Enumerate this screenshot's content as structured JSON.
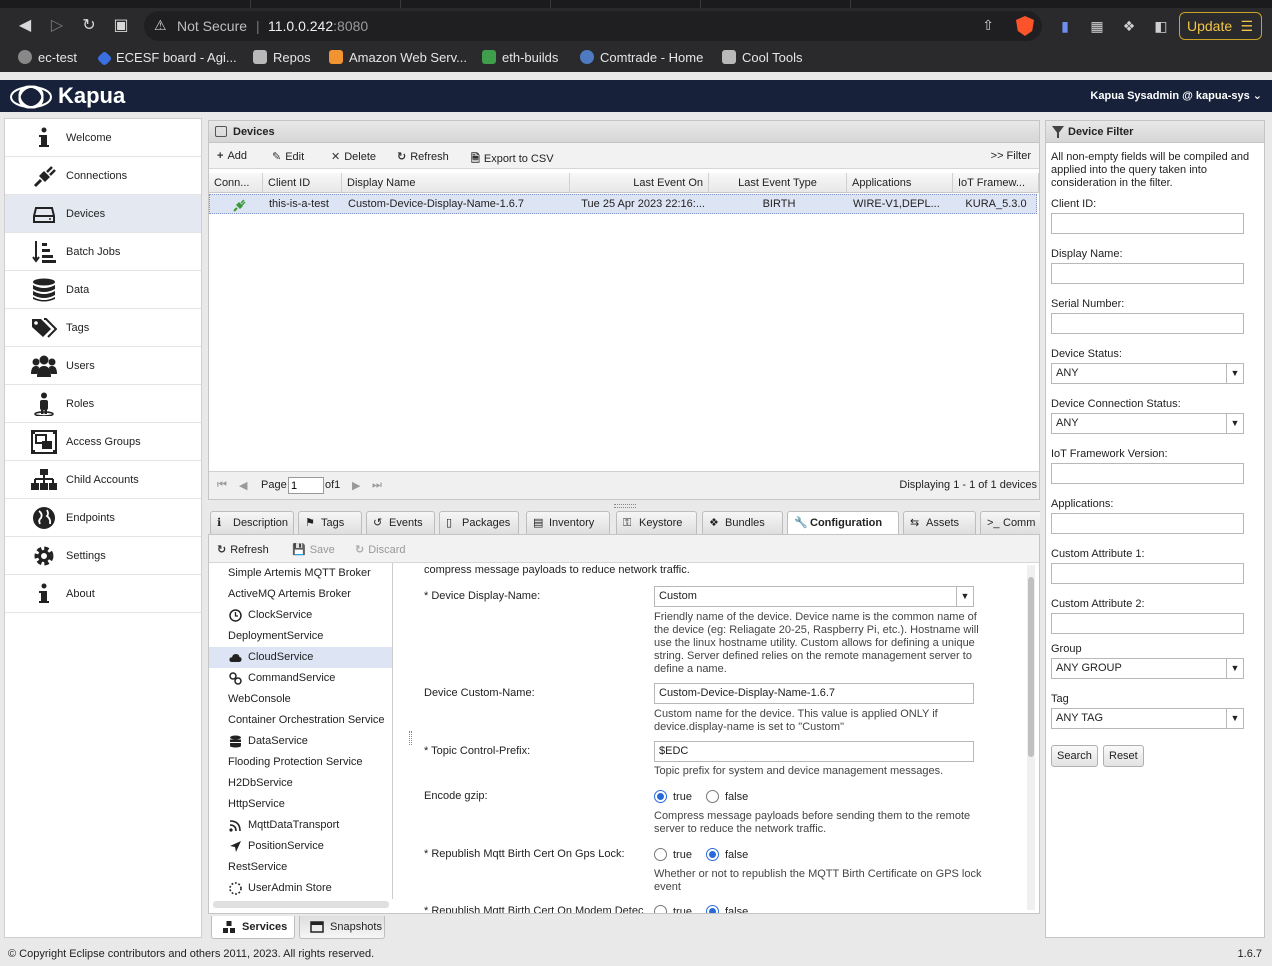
{
  "browser": {
    "security_label": "Not Secure",
    "host": "11.0.0.242",
    "port": ":8080",
    "update_label": "Update",
    "bookmarks": [
      "ec-test",
      "ECESF board - Agi...",
      "Repos",
      "Amazon Web Serv...",
      "eth-builds",
      "Comtrade - Home",
      "Cool Tools"
    ]
  },
  "app": {
    "brand": "Kapua",
    "user": "Kapua Sysadmin @ kapua-sys"
  },
  "nav": [
    {
      "label": "Welcome",
      "icon": "info-icon"
    },
    {
      "label": "Connections",
      "icon": "plug-icon"
    },
    {
      "label": "Devices",
      "icon": "device-icon"
    },
    {
      "label": "Batch Jobs",
      "icon": "batch-jobs-icon"
    },
    {
      "label": "Data",
      "icon": "database-icon"
    },
    {
      "label": "Tags",
      "icon": "tags-icon"
    },
    {
      "label": "Users",
      "icon": "users-icon"
    },
    {
      "label": "Roles",
      "icon": "role-icon"
    },
    {
      "label": "Access Groups",
      "icon": "access-groups-icon"
    },
    {
      "label": "Child Accounts",
      "icon": "sitemap-icon"
    },
    {
      "label": "Endpoints",
      "icon": "globe-icon"
    },
    {
      "label": "Settings",
      "icon": "gear-icon"
    },
    {
      "label": "About",
      "icon": "info-icon"
    }
  ],
  "devices": {
    "title": "Devices",
    "toolbar": {
      "add": "Add",
      "edit": "Edit",
      "delete": "Delete",
      "refresh": "Refresh",
      "export": "Export to CSV",
      "filter": ">> Filter"
    },
    "columns": [
      "Conn...",
      "Client ID",
      "Display Name",
      "Last Event On",
      "Last Event Type",
      "Applications",
      "IoT Framew..."
    ],
    "rows": [
      {
        "client_id": "this-is-a-test",
        "display_name": "Custom-Device-Display-Name-1.6.7",
        "last_event_on": "Tue 25 Apr 2023 22:16:...",
        "last_event_type": "BIRTH",
        "applications": "WIRE-V1,DEPL...",
        "framework": "KURA_5.3.0"
      }
    ],
    "pager": {
      "page_label": "Page",
      "page_value": "1",
      "of_label": "of1",
      "displaying": "Displaying 1 - 1 of 1 devices"
    }
  },
  "tabs": [
    "Description",
    "Tags",
    "Events",
    "Packages",
    "Inventory",
    "Keystore",
    "Bundles",
    "Configuration",
    "Assets",
    "Comm"
  ],
  "config": {
    "toolbar": {
      "refresh": "Refresh",
      "save": "Save",
      "discard": "Discard"
    },
    "services": [
      "Simple Artemis MQTT Broker",
      "ActiveMQ Artemis Broker",
      "ClockService",
      "DeploymentService",
      "CloudService",
      "CommandService",
      "WebConsole",
      "Container Orchestration Service",
      "DataService",
      "Flooding Protection Service",
      "H2DbService",
      "HttpService",
      "MqttDataTransport",
      "PositionService",
      "RestService",
      "UserAdmin Store"
    ],
    "form": {
      "intro": "compress message payloads to reduce network traffic.",
      "display_name_label": "* Device Display-Name:",
      "display_name_value": "Custom",
      "display_name_help": "Friendly name of the device. Device name is the common name of the device (eg: Reliagate 20-25, Raspberry Pi, etc.). Hostname will use the linux hostname utility. Custom allows for defining a unique string. Server defined relies on the remote management server to define a name.",
      "custom_name_label": "Device Custom-Name:",
      "custom_name_value": "Custom-Device-Display-Name-1.6.7",
      "custom_name_help": "Custom name for the device. This value is applied ONLY if device.display-name is set to \"Custom\"",
      "topic_label": "* Topic Control-Prefix:",
      "topic_value": "$EDC",
      "topic_help": "Topic prefix for system and device management messages.",
      "gzip_label": "Encode gzip:",
      "gzip_help": "Compress message payloads before sending them to the remote server to reduce the network traffic.",
      "gps_label": "* Republish Mqtt Birth Cert On Gps Lock:",
      "gps_help": "Whether or not to republish the MQTT Birth Certificate on GPS lock event",
      "modem_label": "* Republish Mqtt Birth Cert On Modem Detec",
      "true_label": "true",
      "false_label": "false"
    }
  },
  "bottom_tabs": [
    "Services",
    "Snapshots"
  ],
  "filter": {
    "title": "Device Filter",
    "description": "All non-empty fields will be compiled and applied into the query taken into consideration in the filter.",
    "fields": {
      "client_id": "Client ID:",
      "display_name": "Display Name:",
      "serial": "Serial Number:",
      "status": "Device Status:",
      "status_value": "ANY",
      "conn_status": "Device Connection Status:",
      "conn_status_value": "ANY",
      "framework": "IoT Framework Version:",
      "applications": "Applications:",
      "attr1": "Custom Attribute 1:",
      "attr2": "Custom Attribute 2:",
      "group": "Group",
      "group_value": "ANY GROUP",
      "tag": "Tag",
      "tag_value": "ANY TAG"
    },
    "search": "Search",
    "reset": "Reset"
  },
  "footer": {
    "copyright": "© Copyright Eclipse contributors and others 2011, 2023. All rights reserved.",
    "version": "1.6.7"
  }
}
